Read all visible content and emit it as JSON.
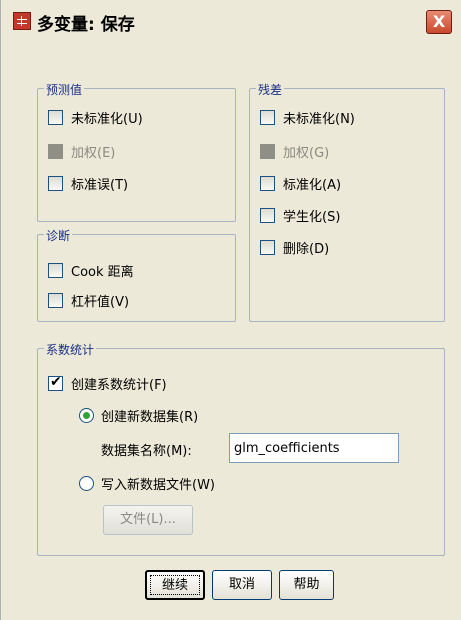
{
  "window": {
    "title": "多变量: 保存",
    "close_label": "X"
  },
  "predicted": {
    "legend": "预测值",
    "items": [
      {
        "label": "未标准化(U)",
        "checked": false,
        "disabled": false
      },
      {
        "label": "加权(E)",
        "checked": false,
        "disabled": true
      },
      {
        "label": "标准误(T)",
        "checked": false,
        "disabled": false
      }
    ]
  },
  "residuals": {
    "legend": "残差",
    "items": [
      {
        "label": "未标准化(N)",
        "checked": false,
        "disabled": false
      },
      {
        "label": "加权(G)",
        "checked": false,
        "disabled": true
      },
      {
        "label": "标准化(A)",
        "checked": false,
        "disabled": false
      },
      {
        "label": "学生化(S)",
        "checked": false,
        "disabled": false
      },
      {
        "label": "删除(D)",
        "checked": false,
        "disabled": false
      }
    ]
  },
  "diagnostics": {
    "legend": "诊断",
    "items": [
      {
        "label": "Cook 距离",
        "checked": false
      },
      {
        "label": "杠杆值(V)",
        "checked": false
      }
    ]
  },
  "coefficients": {
    "legend": "系数统计",
    "create_label": "创建系数统计(F)",
    "create_checked": true,
    "new_dataset_label": "创建新数据集(R)",
    "new_dataset_selected": true,
    "dataset_name_label": "数据集名称(M):",
    "dataset_name_value": "glm_coefficients",
    "write_file_label": "写入新数据文件(W)",
    "write_file_selected": false,
    "file_button_label": "文件(L)..."
  },
  "buttons": {
    "continue": "继续",
    "cancel": "取消",
    "help": "帮助"
  }
}
